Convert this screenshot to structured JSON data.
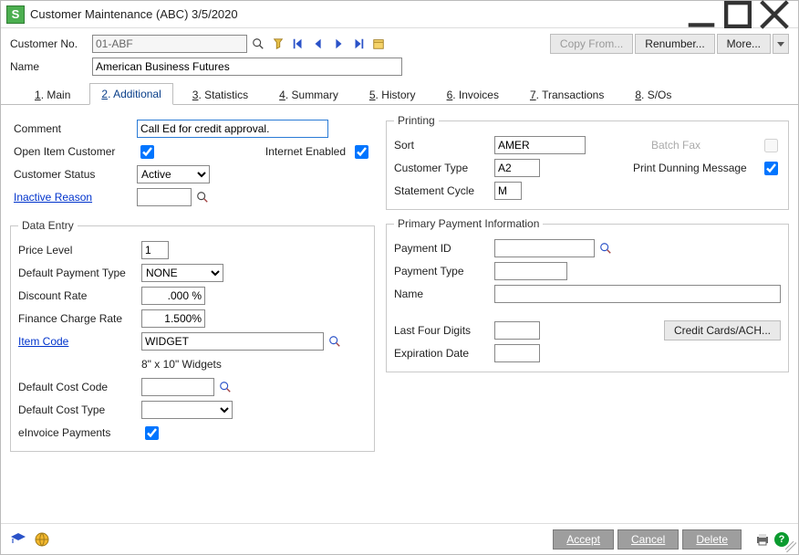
{
  "title": "Customer Maintenance (ABC) 3/5/2020",
  "header_fields": {
    "customer_no_label": "Customer No.",
    "customer_no_value": "01-ABF",
    "name_label": "Name",
    "name_value": "American Business Futures"
  },
  "top_buttons": {
    "copy_from": "Copy From...",
    "renumber": "Renumber...",
    "more": "More..."
  },
  "tabs": [
    {
      "num": "1",
      "label": "Main"
    },
    {
      "num": "2",
      "label": "Additional"
    },
    {
      "num": "3",
      "label": "Statistics"
    },
    {
      "num": "4",
      "label": "Summary"
    },
    {
      "num": "5",
      "label": "History"
    },
    {
      "num": "6",
      "label": "Invoices"
    },
    {
      "num": "7",
      "label": "Transactions"
    },
    {
      "num": "8",
      "label": "S/Os"
    }
  ],
  "active_tab_index": 1,
  "upper_left": {
    "comment_label": "Comment",
    "comment_value": "Call Ed for credit approval.",
    "open_item_label": "Open Item Customer",
    "open_item_checked": true,
    "internet_enabled_label": "Internet Enabled",
    "internet_enabled_checked": true,
    "customer_status_label": "Customer Status",
    "customer_status_value": "Active",
    "inactive_reason_label": "Inactive Reason",
    "inactive_reason_value": ""
  },
  "printing": {
    "legend": "Printing",
    "sort_label": "Sort",
    "sort_value": "AMER",
    "customer_type_label": "Customer Type",
    "customer_type_value": "A2",
    "batch_fax_label": "Batch Fax",
    "batch_fax_checked": false,
    "statement_cycle_label": "Statement Cycle",
    "statement_cycle_value": "M",
    "print_dunning_label": "Print Dunning Message",
    "print_dunning_checked": true
  },
  "data_entry": {
    "legend": "Data Entry",
    "price_level_label": "Price Level",
    "price_level_value": "1",
    "default_payment_type_label": "Default Payment Type",
    "default_payment_type_value": "NONE",
    "discount_rate_label": "Discount Rate",
    "discount_rate_value": ".000 %",
    "finance_charge_label": "Finance Charge Rate",
    "finance_charge_value": "1.500%",
    "item_code_label": "Item Code",
    "item_code_value": "WIDGET",
    "item_code_desc": "8\" x 10\" Widgets",
    "default_cost_code_label": "Default Cost Code",
    "default_cost_code_value": "",
    "default_cost_type_label": "Default Cost Type",
    "default_cost_type_value": "",
    "einvoice_label": "eInvoice Payments",
    "einvoice_checked": true
  },
  "primary_payment": {
    "legend": "Primary Payment Information",
    "payment_id_label": "Payment ID",
    "payment_id_value": "",
    "payment_type_label": "Payment Type",
    "payment_type_value": "",
    "name_label": "Name",
    "name_value": "",
    "last_four_label": "Last Four Digits",
    "last_four_value": "",
    "expiration_label": "Expiration Date",
    "credit_cards_button": "Credit Cards/ACH..."
  },
  "bottom": {
    "accept": "Accept",
    "cancel": "Cancel",
    "delete": "Delete"
  }
}
